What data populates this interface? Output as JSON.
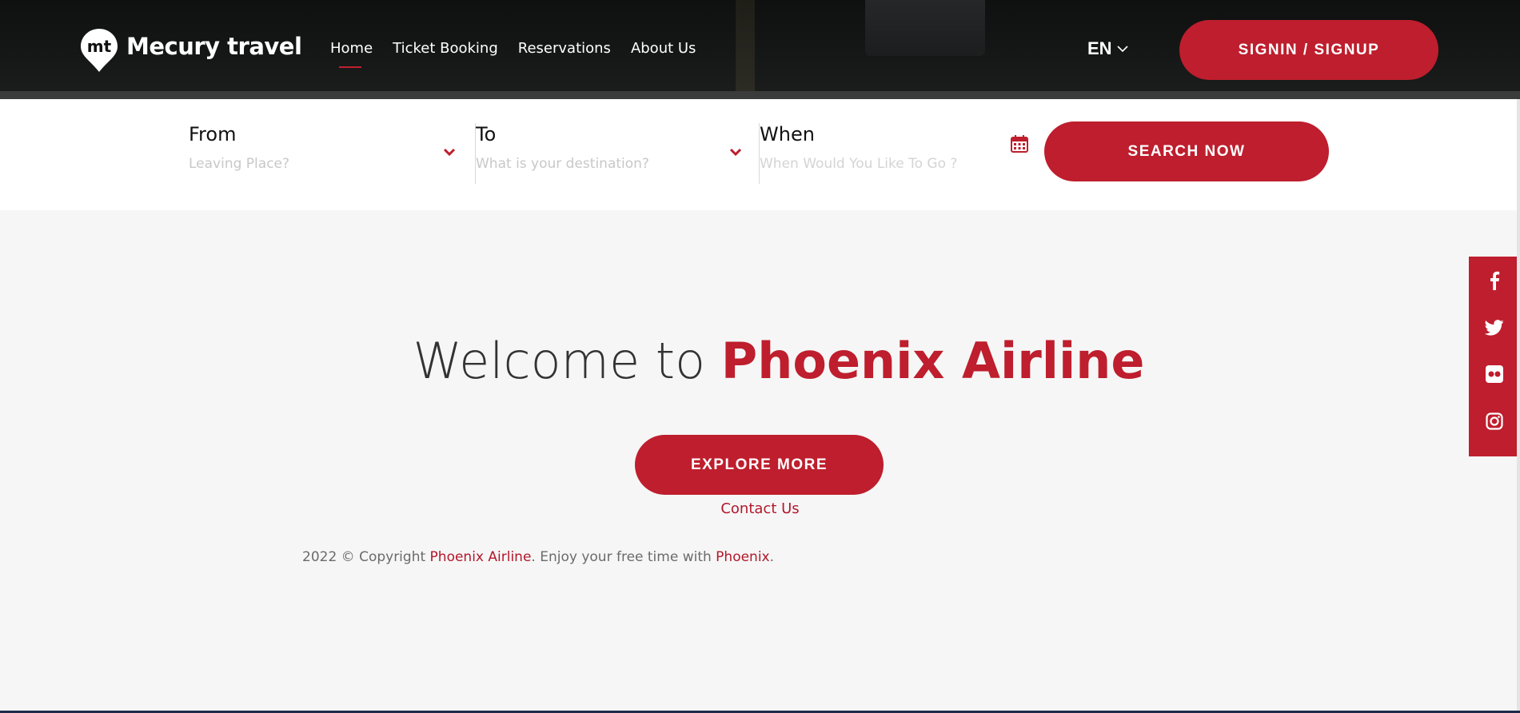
{
  "header": {
    "logo": {
      "mark_text": "mt",
      "name": "Mecury travel"
    },
    "nav": [
      {
        "label": "Home",
        "active": true
      },
      {
        "label": "Ticket Booking",
        "active": false
      },
      {
        "label": "Reservations",
        "active": false
      },
      {
        "label": "About Us",
        "active": false
      }
    ],
    "language": "EN",
    "signin_label": "SIGNIN / SIGNUP"
  },
  "search": {
    "from": {
      "label": "From",
      "placeholder": "Leaving Place?"
    },
    "to": {
      "label": "To",
      "placeholder": "What is your destination?"
    },
    "when": {
      "label": "When",
      "placeholder": "When Would You Like To Go ?"
    },
    "button_label": "SEARCH NOW"
  },
  "hero": {
    "welcome_prefix": "Welcome to",
    "welcome_brand": "Phoenix Airline",
    "explore_label": "EXPLORE MORE",
    "contact_label": "Contact Us"
  },
  "footer": {
    "copy_prefix": "2022 © Copyright",
    "copy_brand": "Phoenix Airline",
    "copy_middle": ". Enjoy your free time with",
    "copy_brand_short": "Phoenix",
    "copy_suffix": "."
  },
  "social": [
    "facebook-icon",
    "twitter-icon",
    "flickr-icon",
    "instagram-icon"
  ],
  "colors": {
    "accent": "#be1e2d",
    "header_bg": "#121313",
    "page_bg": "#f6f6f6"
  }
}
